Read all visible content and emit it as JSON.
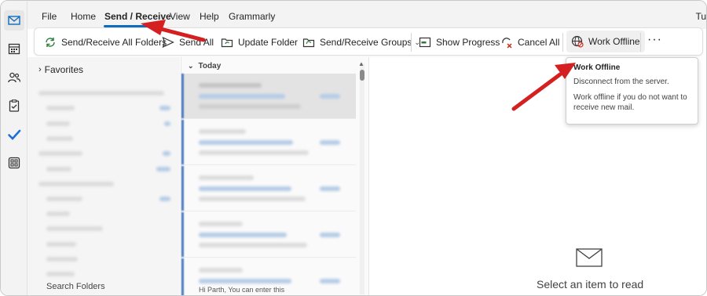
{
  "menu": {
    "items": [
      "File",
      "Home",
      "Send / Receive",
      "View",
      "Help",
      "Grammarly"
    ],
    "active": "Send / Receive",
    "cut_right": "Tu"
  },
  "ribbon": {
    "send_receive_all": "Send/Receive All Folders",
    "send_all": "Send All",
    "update_folder": "Update Folder",
    "send_receive_groups": "Send/Receive Groups",
    "show_progress": "Show Progress",
    "cancel_all": "Cancel All",
    "work_offline": "Work Offline",
    "more": "···"
  },
  "folders": {
    "favorites": "Favorites",
    "search_folders": "Search Folders"
  },
  "message_list": {
    "group": "Today",
    "last_preview": "Hi Parth, You can enter this"
  },
  "reading_pane": {
    "empty_text": "Select an item to read"
  },
  "tooltip": {
    "title": "Work Offline",
    "line1": "Disconnect from the server.",
    "line2": "Work offline if you do not want to receive new mail."
  },
  "colors": {
    "accent": "#0f6cbd",
    "annotation_arrow": "#d42020",
    "checkmark": "#1e6ed8"
  }
}
